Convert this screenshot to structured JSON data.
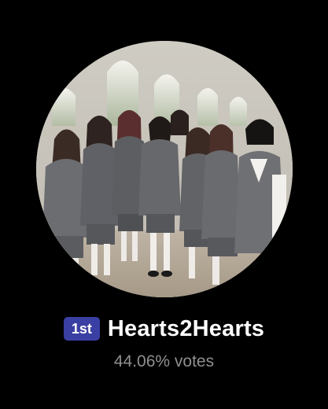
{
  "result": {
    "rank_badge": "1st",
    "name": "Hearts2Hearts",
    "vote_text": "44.06% votes"
  },
  "avatar": {
    "icon": "group-photo-avatar",
    "description_hidden": true
  },
  "colors": {
    "background": "#000000",
    "badge": "#3a3fa3",
    "name": "#ffffff",
    "votes": "#8f8f8f"
  }
}
